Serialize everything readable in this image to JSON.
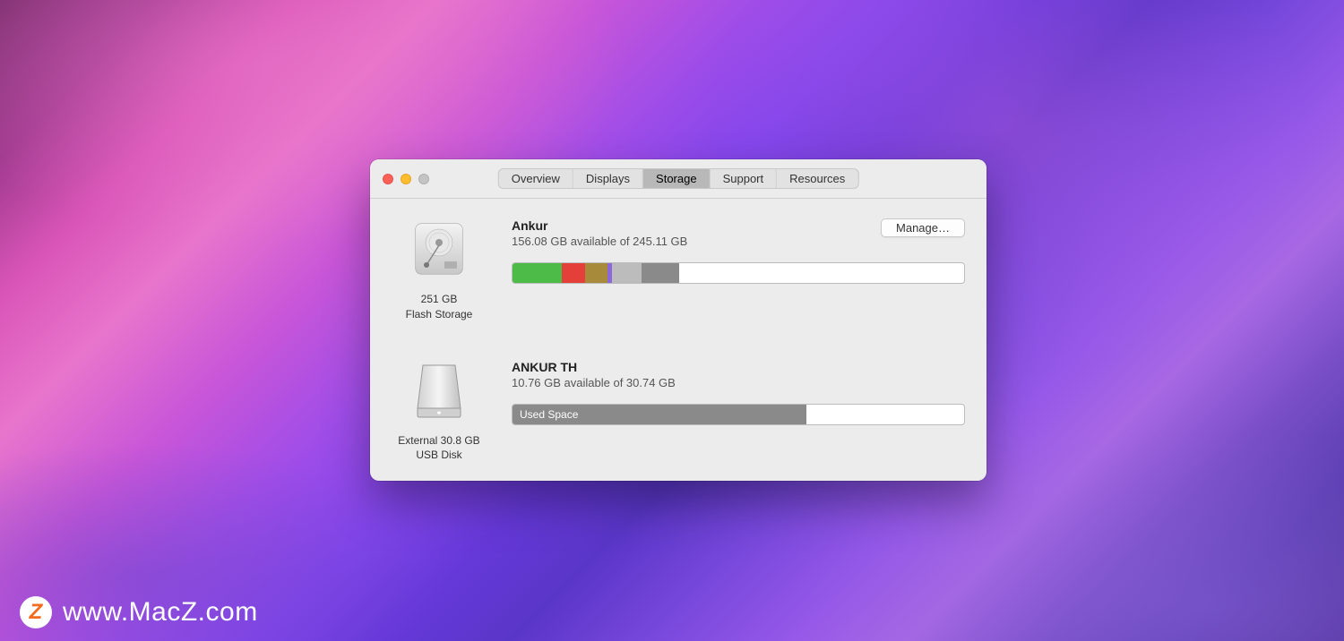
{
  "tabs": {
    "overview": "Overview",
    "displays": "Displays",
    "storage": "Storage",
    "support": "Support",
    "resources": "Resources",
    "active": "storage"
  },
  "drives": [
    {
      "name": "Ankur",
      "available_text": "156.08 GB available of 245.11 GB",
      "caption_line1": "251 GB",
      "caption_line2": "Flash Storage",
      "manage_label": "Manage…",
      "segments": [
        {
          "color": "#4cbb47",
          "percent": 11
        },
        {
          "color": "#e53f3a",
          "percent": 5
        },
        {
          "color": "#a78a3a",
          "percent": 5
        },
        {
          "color": "#8a68d8",
          "percent": 1
        },
        {
          "color": "#bcbcbc",
          "percent": 6.5
        },
        {
          "color": "#8a8a8a",
          "percent": 8.5
        },
        {
          "color": "#ffffff",
          "percent": 63
        }
      ]
    },
    {
      "name": "ANKUR TH",
      "available_text": "10.76 GB available of 30.74 GB",
      "caption_line1": "External 30.8 GB",
      "caption_line2": "USB Disk",
      "used_label": "Used Space",
      "segments": [
        {
          "color": "#8a8a8a",
          "percent": 65
        },
        {
          "color": "#ffffff",
          "percent": 35
        }
      ]
    }
  ],
  "watermark": {
    "icon_letter": "Z",
    "text": "www.MacZ.com"
  }
}
